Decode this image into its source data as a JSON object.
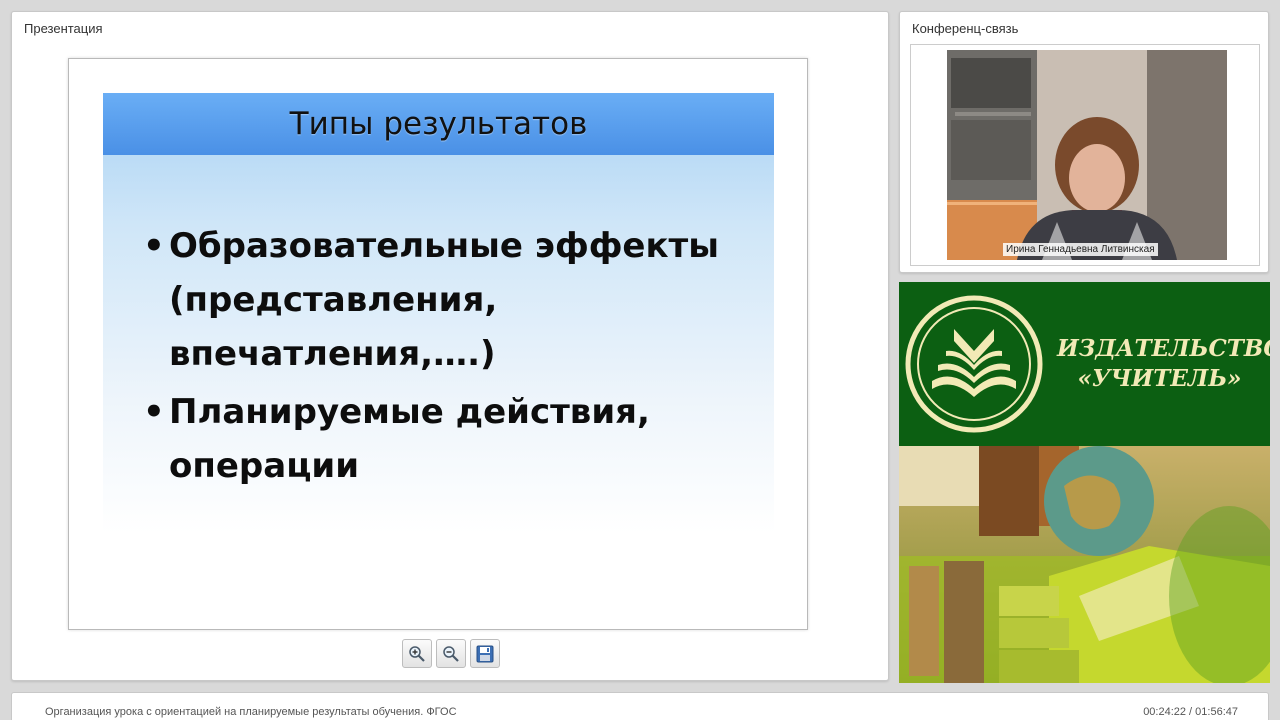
{
  "presentation": {
    "title": "Презентация",
    "slide": {
      "title": "Типы результатов",
      "bullets": [
        "Образовательные эффекты (представления, впечатления,….)",
        "Планируемые действия, операции"
      ]
    },
    "toolbar": {
      "icons": [
        "zoom-in-icon",
        "zoom-out-icon",
        "save-icon"
      ]
    }
  },
  "conference": {
    "title": "Конференц-связь",
    "speaker_name": "Ирина Геннадьевна Литвинская"
  },
  "ad": {
    "line1": "ИЗДАТЕЛЬСТВО",
    "line2": "«УЧИТЕЛЬ»",
    "colors": {
      "background": "#0c5f12",
      "text": "#f2eab6"
    }
  },
  "footer": {
    "course_title": "Организация урока с ориентацией на планируемые результаты обучения. ФГОС",
    "timecode": "00:24:22 / 01:56:47"
  }
}
